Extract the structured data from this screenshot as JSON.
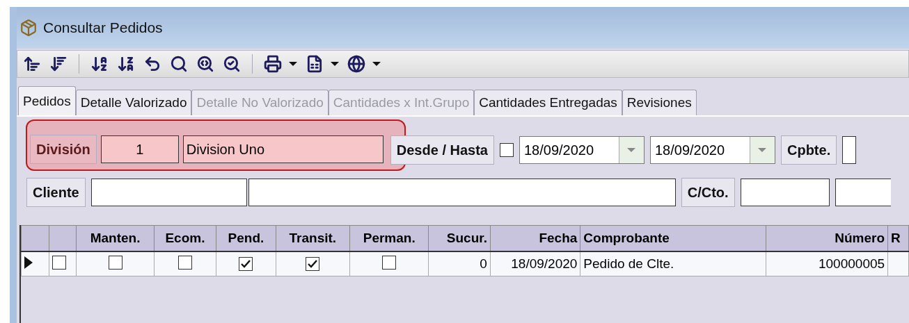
{
  "window": {
    "title": "Consultar Pedidos"
  },
  "tabs": [
    {
      "label": "Pedidos",
      "selected": true,
      "disabled": false
    },
    {
      "label": "Detalle Valorizado",
      "selected": false,
      "disabled": false
    },
    {
      "label": "Detalle No Valorizado",
      "selected": false,
      "disabled": true
    },
    {
      "label": "Cantidades x Int.Grupo",
      "selected": false,
      "disabled": true
    },
    {
      "label": "Cantidades Entregadas",
      "selected": false,
      "disabled": false
    },
    {
      "label": "Revisiones",
      "selected": false,
      "disabled": false
    }
  ],
  "filters": {
    "division": {
      "label": "División",
      "code": "1",
      "name": "Division Uno",
      "highlighted": true
    },
    "range": {
      "label": "Desde / Hasta",
      "checked": false,
      "from": "18/09/2020",
      "to": "18/09/2020"
    },
    "cpbte": {
      "label": "Cpbte."
    },
    "cliente": {
      "label": "Cliente"
    },
    "c_cto": {
      "label": "C/Cto."
    }
  },
  "grid": {
    "columns": [
      {
        "kind": "indicator"
      },
      {
        "kind": "select"
      },
      {
        "label": "Manten.",
        "kind": "check"
      },
      {
        "label": "Ecom.",
        "kind": "check"
      },
      {
        "label": "Pend.",
        "kind": "check"
      },
      {
        "label": "Transit.",
        "kind": "check"
      },
      {
        "label": "Perman.",
        "kind": "check"
      },
      {
        "label": "Sucur.",
        "kind": "number"
      },
      {
        "label": "Fecha",
        "kind": "date"
      },
      {
        "label": "Comprobante",
        "kind": "text"
      },
      {
        "label": "Número",
        "kind": "number"
      },
      {
        "label": "R",
        "kind": "text"
      }
    ],
    "rows": [
      {
        "current": true,
        "cells": [
          null,
          false,
          false,
          false,
          true,
          true,
          false,
          "0",
          "18/09/2020",
          "Pedido de Clte.",
          "100000005",
          null
        ]
      }
    ]
  }
}
